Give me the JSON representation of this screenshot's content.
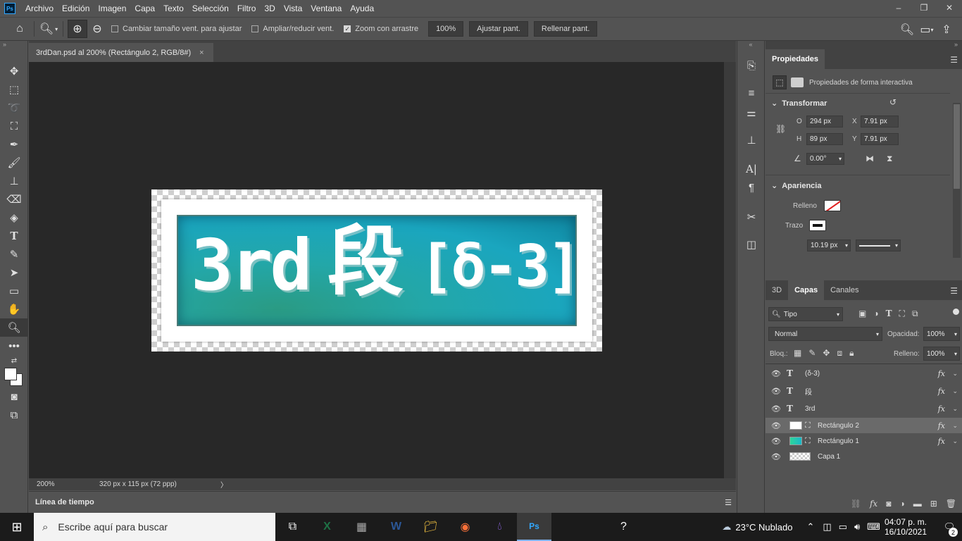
{
  "menubar": {
    "logo": "Ps",
    "items": [
      "Archivo",
      "Edición",
      "Imagen",
      "Capa",
      "Texto",
      "Selección",
      "Filtro",
      "3D",
      "Vista",
      "Ventana",
      "Ayuda"
    ],
    "window_controls": {
      "minimize": "–",
      "restore": "❐",
      "close": "✕"
    }
  },
  "optionsbar": {
    "checkbox_resize": {
      "label": "Cambiar tamaño vent. para ajustar",
      "checked": false
    },
    "checkbox_zoom_all": {
      "label": "Ampliar/reducir vent.",
      "checked": false
    },
    "checkbox_scrubby": {
      "label": "Zoom con arrastre",
      "checked": true
    },
    "zoom_value": "100%",
    "fit_button": "Ajustar pant.",
    "fill_button": "Rellenar pant."
  },
  "document": {
    "tab_title": "3rdDan.psd al 200% (Rectángulo 2, RGB/8#)",
    "tab_close": "×",
    "art": {
      "text_3rd": "3rd",
      "text_dan": "段",
      "text_bracket": "[δ-3]"
    },
    "status_zoom": "200%",
    "status_info": "320 px x 115 px (72 ppp)",
    "status_arrow": "〉"
  },
  "timeline": {
    "label": "Línea de tiempo"
  },
  "properties": {
    "tab": "Propiedades",
    "subtitle": "Propiedades de forma interactiva",
    "transform": {
      "header": "Transformar",
      "w_label": "O",
      "w_value": "294 px",
      "h_label": "H",
      "h_value": "89 px",
      "x_label": "X",
      "x_value": "7.91 px",
      "y_label": "Y",
      "y_value": "7.91 px",
      "angle_value": "0.00°"
    },
    "appearance": {
      "header": "Apariencia",
      "fill_label": "Relleno",
      "stroke_label": "Trazo",
      "stroke_width": "10.19 px"
    }
  },
  "layers_panel": {
    "tabs": [
      "3D",
      "Capas",
      "Canales"
    ],
    "active_tab": "Capas",
    "filter_kind": "Tipo",
    "blend_mode": "Normal",
    "opacity_label": "Opacidad:",
    "opacity_value": "100%",
    "lock_label": "Bloq.:",
    "fill_label": "Relleno:",
    "fill_value": "100%",
    "layers": [
      {
        "name": "(δ-3)",
        "kind": "text",
        "fx": "fx"
      },
      {
        "name": "段",
        "kind": "text",
        "fx": "fx"
      },
      {
        "name": "3rd",
        "kind": "text",
        "fx": "fx"
      },
      {
        "name": "Rectángulo 2",
        "kind": "shape",
        "fx": "fx",
        "selected": true
      },
      {
        "name": "Rectángulo 1",
        "kind": "shape",
        "fx": "fx"
      },
      {
        "name": "Capa 1",
        "kind": "pixel"
      }
    ]
  },
  "taskbar": {
    "search_placeholder": "Escribe aquí para buscar",
    "weather": "23°C  Nublado",
    "time": "04:07 p. m.",
    "date": "16/10/2021",
    "notifications": "2"
  },
  "colors": {
    "accent": "#31a8ff",
    "panel": "#535353",
    "canvas_bg": "#282828",
    "teal": "#1aa6bf"
  }
}
